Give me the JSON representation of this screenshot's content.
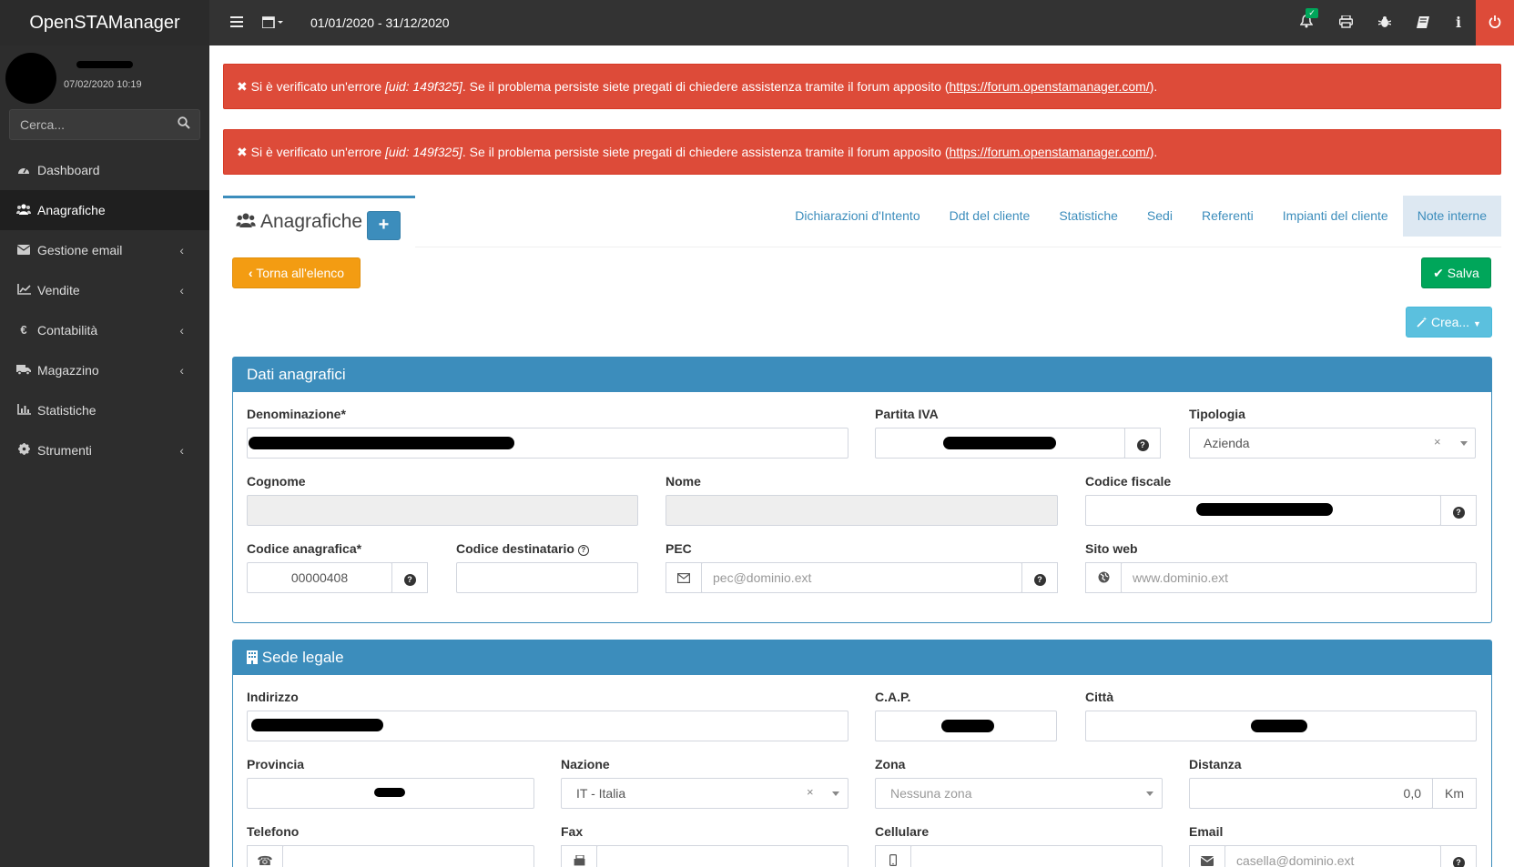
{
  "app": {
    "title": "OpenSTAManager"
  },
  "topbar": {
    "menu_icon": "hamburger-icon",
    "calendar_icon": "calendar-icon",
    "date_range": "01/01/2020 - 31/12/2020",
    "icons": [
      "bell-icon",
      "print-icon",
      "bug-icon",
      "book-icon",
      "info-icon",
      "power-icon"
    ]
  },
  "user": {
    "last_access": "07/02/2020 10:19"
  },
  "search": {
    "placeholder": "Cerca..."
  },
  "sidebar": {
    "items": [
      {
        "label": "Dashboard",
        "icon": "dashboard-icon",
        "has_submenu": false,
        "active": false
      },
      {
        "label": "Anagrafiche",
        "icon": "users-icon",
        "has_submenu": false,
        "active": true
      },
      {
        "label": "Gestione email",
        "icon": "envelope-icon",
        "has_submenu": true,
        "active": false
      },
      {
        "label": "Vendite",
        "icon": "line-chart-icon",
        "has_submenu": true,
        "active": false
      },
      {
        "label": "Contabilità",
        "icon": "euro-icon",
        "has_submenu": true,
        "active": false
      },
      {
        "label": "Magazzino",
        "icon": "truck-icon",
        "has_submenu": true,
        "active": false
      },
      {
        "label": "Statistiche",
        "icon": "bar-chart-icon",
        "has_submenu": false,
        "active": false
      },
      {
        "label": "Strumenti",
        "icon": "cog-icon",
        "has_submenu": true,
        "active": false
      }
    ]
  },
  "alerts": [
    {
      "prefix": "Si è verificato un'errore ",
      "uid": "[uid: 149f325]",
      "middle": ". Se il problema persiste siete pregati di chiedere assistenza tramite il forum apposito (",
      "link": "https://forum.openstamanager.com/",
      "suffix": ")."
    },
    {
      "prefix": "Si è verificato un'errore ",
      "uid": "[uid: 149f325]",
      "middle": ". Se il problema persiste siete pregati di chiedere assistenza tramite il forum apposito (",
      "link": "https://forum.openstamanager.com/",
      "suffix": ")."
    }
  ],
  "module": {
    "title": "Anagrafiche",
    "add_label": "+",
    "tabs": [
      "Dichiarazioni d'Intento",
      "Ddt del cliente",
      "Statistiche",
      "Sedi",
      "Referenti",
      "Impianti del cliente",
      "Note interne"
    ],
    "active_tab": "Note interne"
  },
  "actions": {
    "back": "Torna all'elenco",
    "save": "Salva",
    "create": "Crea..."
  },
  "dati_anagrafici": {
    "title": "Dati anagrafici",
    "denominazione": {
      "label": "Denominazione*"
    },
    "partita_iva": {
      "label": "Partita IVA"
    },
    "tipologia": {
      "label": "Tipologia",
      "value": "Azienda"
    },
    "cognome": {
      "label": "Cognome"
    },
    "nome": {
      "label": "Nome"
    },
    "codice_fiscale": {
      "label": "Codice fiscale"
    },
    "codice_anagrafica": {
      "label": "Codice anagrafica*",
      "value": "00000408"
    },
    "codice_destinatario": {
      "label": "Codice destinatario"
    },
    "pec": {
      "label": "PEC",
      "placeholder": "pec@dominio.ext"
    },
    "sito_web": {
      "label": "Sito web",
      "placeholder": "www.dominio.ext"
    }
  },
  "sede_legale": {
    "title": "Sede legale",
    "indirizzo": {
      "label": "Indirizzo"
    },
    "cap": {
      "label": "C.A.P."
    },
    "citta": {
      "label": "Città"
    },
    "provincia": {
      "label": "Provincia"
    },
    "nazione": {
      "label": "Nazione",
      "value": "IT - Italia"
    },
    "zona": {
      "label": "Zona",
      "placeholder": "Nessuna zona"
    },
    "distanza": {
      "label": "Distanza",
      "value": "0,0",
      "unit": "Km"
    },
    "telefono": {
      "label": "Telefono"
    },
    "fax": {
      "label": "Fax"
    },
    "cellulare": {
      "label": "Cellulare"
    },
    "email": {
      "label": "Email",
      "placeholder": "casella@dominio.ext"
    }
  }
}
